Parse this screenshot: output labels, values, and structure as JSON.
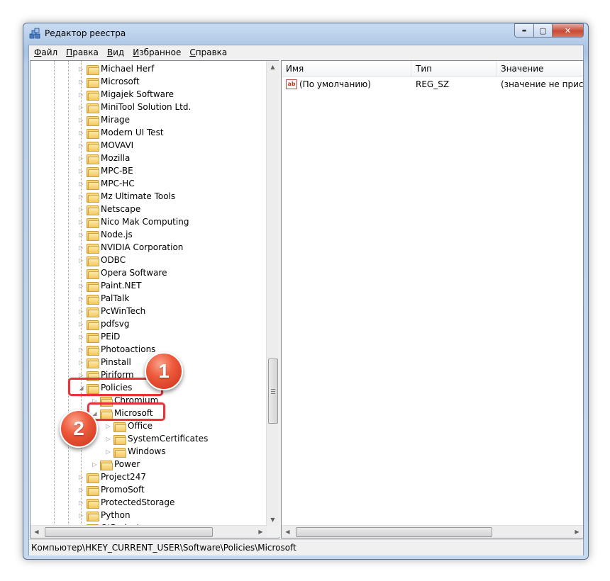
{
  "window": {
    "title": "Редактор реестра",
    "controls": {
      "minimize": "▬",
      "maximize": "▢",
      "close": "✕"
    }
  },
  "menu": [
    {
      "label": "Файл",
      "key": "Ф",
      "rest": "айл"
    },
    {
      "label": "Правка",
      "key": "П",
      "rest": "равка"
    },
    {
      "label": "Вид",
      "key": "В",
      "rest": "ид"
    },
    {
      "label": "Избранное",
      "key": "И",
      "rest": "збранное"
    },
    {
      "label": "Справка",
      "key": "С",
      "rest": "правка"
    }
  ],
  "tree": {
    "nodes": [
      {
        "label": "Michael Herf",
        "level": 0,
        "expander": "▷"
      },
      {
        "label": "Microsoft",
        "level": 0,
        "expander": "▷"
      },
      {
        "label": "Migajek Software",
        "level": 0,
        "expander": "▷"
      },
      {
        "label": "MiniTool Solution Ltd.",
        "level": 0,
        "expander": "▷"
      },
      {
        "label": "Mirage",
        "level": 0,
        "expander": "▷"
      },
      {
        "label": "Modern UI Test",
        "level": 0,
        "expander": "▷"
      },
      {
        "label": "MOVAVI",
        "level": 0,
        "expander": "▷"
      },
      {
        "label": "Mozilla",
        "level": 0,
        "expander": "▷"
      },
      {
        "label": "MPC-BE",
        "level": 0,
        "expander": "▷"
      },
      {
        "label": "MPC-HC",
        "level": 0,
        "expander": "▷"
      },
      {
        "label": "Mz Ultimate Tools",
        "level": 0,
        "expander": "▷"
      },
      {
        "label": "Netscape",
        "level": 0,
        "expander": "▷"
      },
      {
        "label": "Nico Mak Computing",
        "level": 0,
        "expander": "▷"
      },
      {
        "label": "Node.js",
        "level": 0,
        "expander": "▷"
      },
      {
        "label": "NVIDIA Corporation",
        "level": 0,
        "expander": "▷"
      },
      {
        "label": "ODBC",
        "level": 0,
        "expander": "▷"
      },
      {
        "label": "Opera Software",
        "level": 0,
        "expander": ""
      },
      {
        "label": "Paint.NET",
        "level": 0,
        "expander": "▷"
      },
      {
        "label": "PalTalk",
        "level": 0,
        "expander": "▷"
      },
      {
        "label": "PcWinTech",
        "level": 0,
        "expander": "▷"
      },
      {
        "label": "pdfsvg",
        "level": 0,
        "expander": "▷"
      },
      {
        "label": "PEiD",
        "level": 0,
        "expander": "▷"
      },
      {
        "label": "Photoactions",
        "level": 0,
        "expander": "▷"
      },
      {
        "label": "Pinstall",
        "level": 0,
        "expander": "▷"
      },
      {
        "label": "Piriform",
        "level": 0,
        "expander": "▷"
      },
      {
        "label": "Policies",
        "level": 0,
        "expander": "◢"
      },
      {
        "label": "Chromium",
        "level": 1,
        "expander": "▷"
      },
      {
        "label": "Microsoft",
        "level": 1,
        "expander": "◢"
      },
      {
        "label": "Office",
        "level": 2,
        "expander": "▷"
      },
      {
        "label": "SystemCertificates",
        "level": 2,
        "expander": "▷"
      },
      {
        "label": "Windows",
        "level": 2,
        "expander": "▷"
      },
      {
        "label": "Power",
        "level": 1,
        "expander": "▷"
      },
      {
        "label": "Project247",
        "level": 0,
        "expander": "▷"
      },
      {
        "label": "PromoSoft",
        "level": 0,
        "expander": "▷"
      },
      {
        "label": "ProtectedStorage",
        "level": 0,
        "expander": "▷"
      },
      {
        "label": "Python",
        "level": 0,
        "expander": "▷"
      },
      {
        "label": "QtProject",
        "level": 0,
        "expander": "▷"
      }
    ]
  },
  "list": {
    "columns": [
      {
        "label": "Имя"
      },
      {
        "label": "Тип"
      },
      {
        "label": "Значение"
      }
    ],
    "rows": [
      {
        "name": "(По умолчанию)",
        "type": "REG_SZ",
        "value": "(значение не присвоено)",
        "icon": "ab"
      }
    ]
  },
  "status": {
    "path": "Компьютер\\HKEY_CURRENT_USER\\Software\\Policies\\Microsoft"
  },
  "annotations": [
    {
      "number": "1"
    },
    {
      "number": "2"
    }
  ],
  "scroll": {
    "up": "▲",
    "down": "▼",
    "left": "◀",
    "right": "▶"
  },
  "colors": {
    "highlight": "#e8333a",
    "badge": "#ee5a3b",
    "title_gradient_top": "#c9dcf2"
  }
}
